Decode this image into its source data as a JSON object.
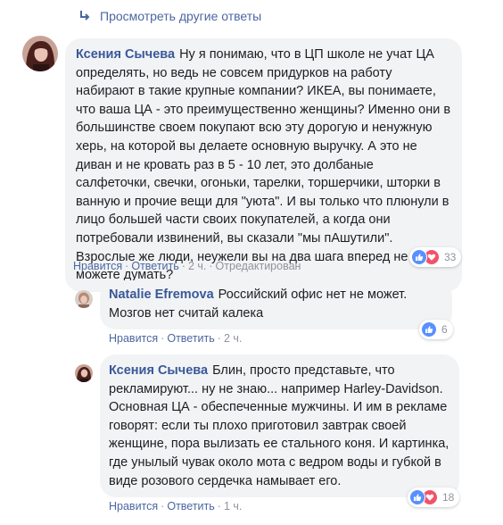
{
  "view_more": {
    "label": "Просмотреть другие ответы"
  },
  "comments": [
    {
      "author": "Ксения Сычева",
      "text": "Ну я понимаю, что в ЦП школе не учат ЦА определять, но ведь не совсем придурков на работу набирают в такие крупные компании? ИКЕА, вы понимаете, что ваша ЦА - это преимущественно женщины? Именно они в большинстве своем покупают всю эту дорогую и ненужную херь, на которой вы делаете основную выручку. А это не диван и не кровать раз в 5 - 10 лет, это долбаные салфеточки, свечки, огоньки, тарелки, торшерчики, шторки в ванную и прочие вещи для \"уюта\". И вы только что плюнули в лицо большей части своих покупателей, а когда они потребовали извинений, вы сказали \"мы пАшутили\". Взрослые же люди, неужели вы на два шага вперед не можете думать?",
      "like_label": "Нравится",
      "reply_label": "Ответить",
      "time": "2 ч.",
      "edited": "Отредактирован",
      "reactions_count": "33",
      "reaction_icons": [
        "like-icon",
        "love-icon"
      ]
    },
    {
      "author": "Natalie Efremova",
      "text": "Российский офис нет не может. Мозгов нет считай калека",
      "like_label": "Нравится",
      "reply_label": "Ответить",
      "time": "2 ч.",
      "reactions_count": "6",
      "reaction_icons": [
        "like-icon"
      ]
    },
    {
      "author": "Ксения Сычева",
      "text": "Блин, просто представьте, что рекламируют... ну не знаю... например Harley-Davidson. Основная ЦА - обеспеченные мужчины. И им в рекламе говорят: если ты плохо приготовил завтрак своей женщине, пора вылизать ее стального коня. И картинка, где унылый чувак около мота с ведром воды и губкой в виде розового сердечка намывает его.",
      "like_label": "Нравится",
      "reply_label": "Ответить",
      "time": "1 ч.",
      "reactions_count": "18",
      "reaction_icons": [
        "like-icon",
        "love-icon"
      ]
    }
  ],
  "colors": {
    "link": "#4b67a1",
    "author": "#385898",
    "bubble": "#f2f3f5",
    "meta": "#90949c",
    "like": "#5890ff",
    "love": "#f25268"
  }
}
